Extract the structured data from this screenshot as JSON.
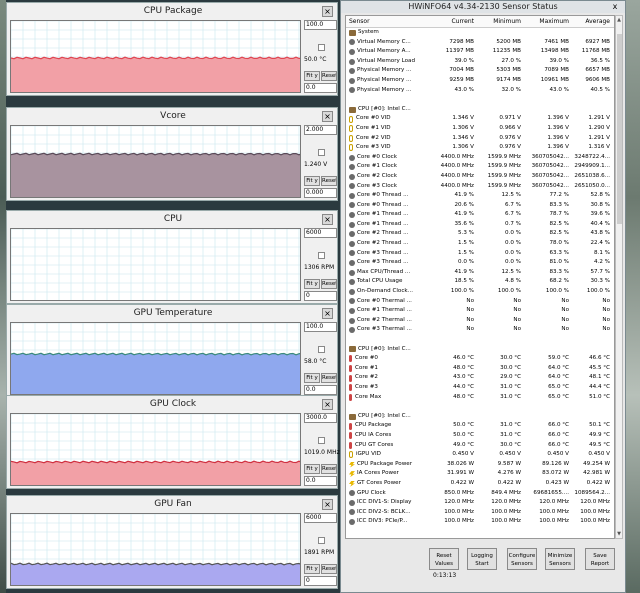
{
  "graphs": [
    {
      "title": "CPU Package",
      "max": "100.0",
      "current": "50.0 °C",
      "min": "0.0",
      "fit": "Fit y",
      "reset": "Reset",
      "fill": "#f2a0a6",
      "line": "#e04450",
      "level": 0.5
    },
    {
      "title": "Vcore",
      "max": "2.000",
      "current": "1.240 V",
      "min": "0.000",
      "fit": "Fit y",
      "reset": "Reset",
      "fill": "#a8939f",
      "line": "#5a4a58",
      "level": 0.62
    },
    {
      "title": "CPU",
      "max": "6000",
      "current": "1306 RPM",
      "min": "0",
      "fit": "Fit y",
      "reset": "Reset",
      "fill": "#cfe8ea",
      "line": "#a8cdd2",
      "level": 0.0
    },
    {
      "title": "GPU Temperature",
      "max": "100.0",
      "current": "58.0 °C",
      "min": "0.0",
      "fit": "Fit y",
      "reset": "Reset",
      "fill": "#8fa8ee",
      "line": "#3a8a7c",
      "level": 0.58
    },
    {
      "title": "GPU Clock",
      "max": "3000.0",
      "current": "1019.0 MHz",
      "min": "0.0",
      "fit": "Fit y",
      "reset": "Reset",
      "fill": "#f2a0a6",
      "line": "#d03040",
      "level": 0.34
    },
    {
      "title": "GPU Fan",
      "max": "6000",
      "current": "1891 RPM",
      "min": "0",
      "fit": "Fit y",
      "reset": "Reset",
      "fill": "#aaa8f0",
      "line": "#555",
      "level": 0.31
    }
  ],
  "main": {
    "title": "HWiNFO64 v4.34-2130 Sensor Status",
    "close": "x",
    "columns": [
      "Sensor",
      "Current",
      "Minimum",
      "Maximum",
      "Average"
    ],
    "sections": [
      {
        "label": "System",
        "rows": [
          [
            "Virtual Memory C...",
            "7298 MB",
            "5200 MB",
            "7461 MB",
            "6927 MB"
          ],
          [
            "Virtual Memory A...",
            "11397 MB",
            "11235 MB",
            "13498 MB",
            "11768 MB"
          ],
          [
            "Virtual Memory Load",
            "39.0 %",
            "27.0 %",
            "39.0 %",
            "36.5 %"
          ],
          [
            "Physical Memory ...",
            "7004 MB",
            "5303 MB",
            "7089 MB",
            "6657 MB"
          ],
          [
            "Physical Memory ...",
            "9259 MB",
            "9174 MB",
            "10961 MB",
            "9606 MB"
          ],
          [
            "Physical Memory ...",
            "43.0 %",
            "32.0 %",
            "43.0 %",
            "40.5 %"
          ]
        ]
      },
      {
        "label": "CPU [#0]: Intel C...",
        "rows": [
          [
            "Core #0 VID",
            "1.346 V",
            "0.971 V",
            "1.396 V",
            "1.291 V"
          ],
          [
            "Core #1 VID",
            "1.306 V",
            "0.966 V",
            "1.396 V",
            "1.290 V"
          ],
          [
            "Core #2 VID",
            "1.346 V",
            "0.976 V",
            "1.396 V",
            "1.291 V"
          ],
          [
            "Core #3 VID",
            "1.306 V",
            "0.976 V",
            "1.396 V",
            "1.316 V"
          ],
          [
            "Core #0 Clock",
            "4400.0 MHz",
            "1599.9 MHz",
            "360705042...",
            "3248722.4..."
          ],
          [
            "Core #1 Clock",
            "4400.0 MHz",
            "1599.9 MHz",
            "360705042...",
            "2949909.1..."
          ],
          [
            "Core #2 Clock",
            "4400.0 MHz",
            "1599.9 MHz",
            "360705042...",
            "2651038.6..."
          ],
          [
            "Core #3 Clock",
            "4400.0 MHz",
            "1599.9 MHz",
            "360705042...",
            "2651050.0..."
          ],
          [
            "Core #0 Thread ...",
            "41.9 %",
            "12.5 %",
            "77.2 %",
            "52.8 %"
          ],
          [
            "Core #0 Thread ...",
            "20.6 %",
            "6.7 %",
            "83.3 %",
            "30.8 %"
          ],
          [
            "Core #1 Thread ...",
            "41.9 %",
            "6.7 %",
            "78.7 %",
            "39.6 %"
          ],
          [
            "Core #1 Thread ...",
            "35.6 %",
            "0.7 %",
            "82.5 %",
            "40.4 %"
          ],
          [
            "Core #2 Thread ...",
            "5.3 %",
            "0.0 %",
            "82.5 %",
            "43.8 %"
          ],
          [
            "Core #2 Thread ...",
            "1.5 %",
            "0.0 %",
            "78.0 %",
            "22.4 %"
          ],
          [
            "Core #3 Thread ...",
            "1.5 %",
            "0.0 %",
            "63.3 %",
            "8.1 %"
          ],
          [
            "Core #3 Thread ...",
            "0.0 %",
            "0.0 %",
            "81.0 %",
            "4.2 %"
          ],
          [
            "Max CPU/Thread ...",
            "41.9 %",
            "12.5 %",
            "83.3 %",
            "57.7 %"
          ],
          [
            "Total CPU Usage",
            "18.5 %",
            "4.8 %",
            "68.2 %",
            "30.3 %"
          ],
          [
            "On-Demand Clock...",
            "100.0 %",
            "100.0 %",
            "100.0 %",
            "100.0 %"
          ],
          [
            "Core #0 Thermal ...",
            "No",
            "No",
            "No",
            "No"
          ],
          [
            "Core #1 Thermal ...",
            "No",
            "No",
            "No",
            "No"
          ],
          [
            "Core #2 Thermal ...",
            "No",
            "No",
            "No",
            "No"
          ],
          [
            "Core #3 Thermal ...",
            "No",
            "No",
            "No",
            "No"
          ]
        ]
      },
      {
        "label": "CPU [#0]: Intel C...",
        "rows": [
          [
            "Core #0",
            "46.0 °C",
            "30.0 °C",
            "59.0 °C",
            "46.6 °C"
          ],
          [
            "Core #1",
            "48.0 °C",
            "30.0 °C",
            "64.0 °C",
            "45.5 °C"
          ],
          [
            "Core #2",
            "43.0 °C",
            "29.0 °C",
            "64.0 °C",
            "48.1 °C"
          ],
          [
            "Core #3",
            "44.0 °C",
            "31.0 °C",
            "65.0 °C",
            "44.4 °C"
          ],
          [
            "Core Max",
            "48.0 °C",
            "31.0 °C",
            "65.0 °C",
            "51.0 °C"
          ]
        ]
      },
      {
        "label": "CPU [#0]: Intel C...",
        "rows": [
          [
            "CPU Package",
            "50.0 °C",
            "31.0 °C",
            "66.0 °C",
            "50.1 °C"
          ],
          [
            "CPU IA Cores",
            "50.0 °C",
            "31.0 °C",
            "66.0 °C",
            "49.9 °C"
          ],
          [
            "CPU GT Cores",
            "49.0 °C",
            "30.0 °C",
            "66.0 °C",
            "49.5 °C"
          ],
          [
            "iGPU VID",
            "0.450 V",
            "0.450 V",
            "0.450 V",
            "0.450 V"
          ],
          [
            "CPU Package Power",
            "38.026 W",
            "9.587 W",
            "89.126 W",
            "49.254 W"
          ],
          [
            "IA Cores Power",
            "31.991 W",
            "4.276 W",
            "83.072 W",
            "42.981 W"
          ],
          [
            "GT Cores Power",
            "0.422 W",
            "0.422 W",
            "0.423 W",
            "0.422 W"
          ],
          [
            "GPU Clock",
            "850.0 MHz",
            "849.4 MHz",
            "69681655....",
            "1089564.2..."
          ],
          [
            "ICC DIV1-S: Display",
            "120.0 MHz",
            "120.0 MHz",
            "120.0 MHz",
            "120.0 MHz"
          ],
          [
            "ICC DIV2-S: BCLK...",
            "100.0 MHz",
            "100.0 MHz",
            "100.0 MHz",
            "100.0 MHz"
          ],
          [
            "ICC DIV3: PCIe/P...",
            "100.0 MHz",
            "100.0 MHz",
            "100.0 MHz",
            "100.0 MHz"
          ]
        ]
      }
    ],
    "toolbar": {
      "reset": "Reset Values",
      "logging": "Logging Start",
      "configure": "Configure Sensors",
      "minimize": "Minimize Sensors",
      "save": "Save Report",
      "timer": "0:13:13"
    }
  }
}
